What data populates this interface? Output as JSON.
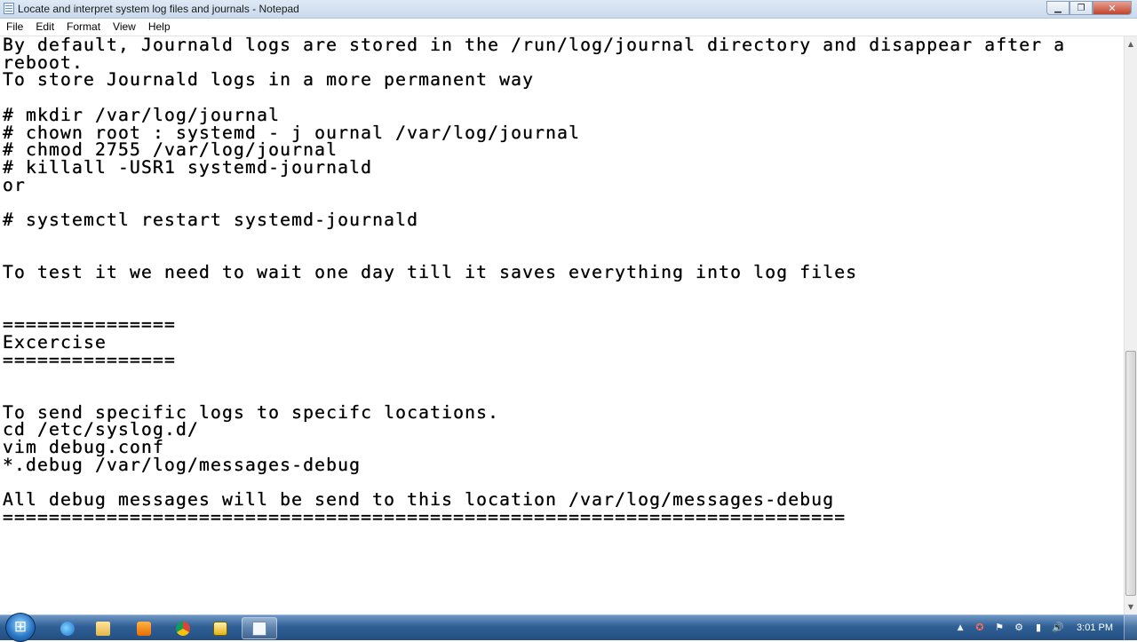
{
  "window": {
    "title": "Locate and interpret system log files and journals - Notepad"
  },
  "menu": [
    "File",
    "Edit",
    "Format",
    "View",
    "Help"
  ],
  "document": {
    "text": "By default, Journald logs are stored in the /run/log/journal directory and disappear after a\nreboot.\nTo store Journald logs in a more permanent way\n\n# mkdir /var/log/journal\n# chown root : systemd - j ournal /var/log/journal\n# chmod 2755 /var/log/journal\n# killall -USR1 systemd-journald\nor\n\n# systemctl restart systemd-journald\n\n\nTo test it we need to wait one day till it saves everything into log files\n\n\n===============\nExcercise\n===============\n\n\nTo send specific logs to specifc locations.\ncd /etc/syslog.d/\nvim debug.conf\n*.debug /var/log/messages-debug\n\nAll debug messages will be send to this location /var/log/messages-debug\n========================================================================="
  },
  "taskbar": {
    "clock": "3:01 PM",
    "apps": [
      {
        "name": "internet-explorer-icon"
      },
      {
        "name": "windows-explorer-icon"
      },
      {
        "name": "media-player-icon"
      },
      {
        "name": "chrome-icon"
      },
      {
        "name": "app-icon"
      },
      {
        "name": "notepad-icon",
        "active": true
      }
    ]
  }
}
